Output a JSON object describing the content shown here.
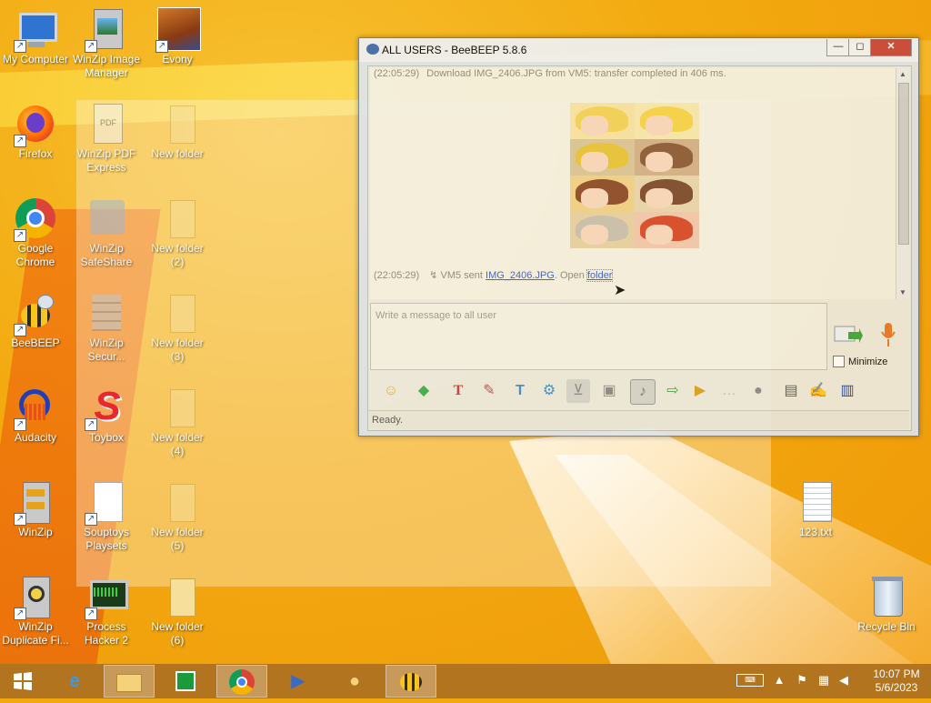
{
  "desktop": {
    "icons": [
      {
        "label": "My Computer"
      },
      {
        "label": "WinZip Image\nManager"
      },
      {
        "label": "Evony"
      },
      {
        "label": "Firefox"
      },
      {
        "label": "WinZip PDF\nExpress"
      },
      {
        "label": "New folder"
      },
      {
        "label": "Google\nChrome"
      },
      {
        "label": "WinZip\nSafeShare"
      },
      {
        "label": "New folder\n(2)"
      },
      {
        "label": "BeeBEEP"
      },
      {
        "label": "WinZip\nSecur..."
      },
      {
        "label": "New folder\n(3)"
      },
      {
        "label": "Audacity"
      },
      {
        "label": "Toybox"
      },
      {
        "label": "New folder\n(4)"
      },
      {
        "label": "WinZip"
      },
      {
        "label": "Souptoys\nPlaysets"
      },
      {
        "label": "New folder\n(5)"
      },
      {
        "label": "WinZip\nDuplicate Fi..."
      },
      {
        "label": "Process\nHacker 2"
      },
      {
        "label": "New folder\n(6)"
      },
      {
        "label": "123.txt"
      },
      {
        "label": "Recycle Bin"
      }
    ]
  },
  "chat_window": {
    "title": "ALL USERS - BeeBEEP 5.8.6",
    "controls": {
      "minimize": "—",
      "maximize": "◻",
      "close": "✕"
    },
    "log": {
      "line1": {
        "time": "(22:05:29)",
        "text": "Download IMG_2406.JPG from VM5: transfer completed in 406 ms."
      },
      "line2": {
        "time": "(22:05:29)",
        "prefix": "VM5 sent",
        "file": "IMG_2406.JPG",
        "middle": ". Open",
        "folder": "folder"
      }
    },
    "input_placeholder": "Write a message to all user",
    "minimize_label": "Minimize",
    "status": "Ready."
  },
  "taskbar": {
    "clock_time": "10:07 PM",
    "clock_date": "5/6/2023"
  },
  "colors": {
    "desktop_orange": "#f3aa10",
    "taskbar": "#ac7020",
    "link": "#3a62c8",
    "close_red": "#c7463c"
  }
}
